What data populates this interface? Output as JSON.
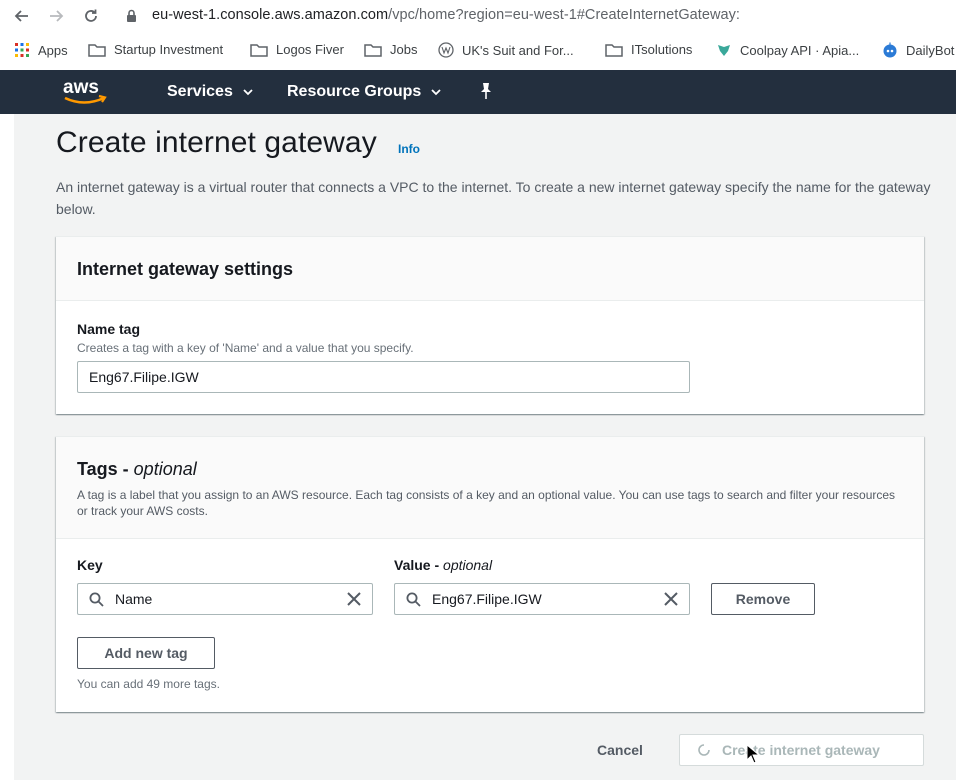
{
  "browser": {
    "url_host": "eu-west-1.console.aws.amazon.com",
    "url_path": "/vpc/home?region=eu-west-1#CreateInternetGateway:",
    "bookmarks": [
      {
        "label": "Apps",
        "icon": "apps-grid-icon"
      },
      {
        "label": "Startup Investment",
        "icon": "folder-icon"
      },
      {
        "label": "Logos Fiver",
        "icon": "folder-icon"
      },
      {
        "label": "Jobs",
        "icon": "folder-icon"
      },
      {
        "label": "UK's Suit and For...",
        "icon": "site-favicon-icon"
      },
      {
        "label": "ITsolutions",
        "icon": "folder-icon"
      },
      {
        "label": "Coolpay API · Apia...",
        "icon": "coolpay-favicon-icon"
      },
      {
        "label": "DailyBot",
        "icon": "dailybot-favicon-icon"
      }
    ]
  },
  "aws_nav": {
    "logo": "aws",
    "services_label": "Services",
    "resource_groups_label": "Resource Groups",
    "pin_icon": "pushpin-icon",
    "colors": {
      "bar": "#232f3e",
      "accent": "#ff9900"
    }
  },
  "page": {
    "title": "Create internet gateway",
    "info_label": "Info",
    "description": "An internet gateway is a virtual router that connects a VPC to the internet. To create a new internet gateway specify the name for the gateway below."
  },
  "settings_panel": {
    "title": "Internet gateway settings",
    "name_tag_label": "Name tag",
    "name_tag_hint": "Creates a tag with a key of 'Name' and a value that you specify.",
    "name_tag_value": "Eng67.Filipe.IGW"
  },
  "tags_panel": {
    "title_main": "Tags - ",
    "title_optional": "optional",
    "description": "A tag is a label that you assign to an AWS resource. Each tag consists of a key and an optional value. You can use tags to search and filter your resources or track your AWS costs.",
    "key_label": "Key",
    "value_label_main": "Value - ",
    "value_label_optional": "optional",
    "rows": [
      {
        "key": "Name",
        "value": "Eng67.Filipe.IGW"
      }
    ],
    "remove_label": "Remove",
    "add_tag_label": "Add new tag",
    "remaining_hint": "You can add 49 more tags."
  },
  "footer": {
    "cancel_label": "Cancel",
    "create_label": "Create internet gateway"
  }
}
